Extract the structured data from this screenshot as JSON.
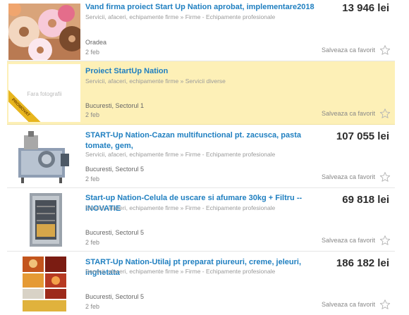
{
  "listings": [
    {
      "title": "Vand firma proiect Start Up Nation aprobat, implementare2018",
      "category": "Servicii, afaceri, echipamente firme » Firme - Echipamente profesionale",
      "price": "13 946 lei",
      "location": "Oradea",
      "date": "2 feb",
      "fav_label": "Salveaza ca favorit"
    },
    {
      "title": "Proiect StartUp Nation",
      "category": "Servicii, afaceri, echipamente firme » Servicii diverse",
      "price": "",
      "location": "Bucuresti, Sectorul 1",
      "date": "2 feb",
      "fav_label": "Salveaza ca favorit",
      "placeholder_text": "Fara fotografii",
      "promo_badge": "PROMOVAT"
    },
    {
      "title": "START-Up Nation-Cazan multifunctional pt. zacusca, pasta tomate, gem,",
      "category": "Servicii, afaceri, echipamente firme » Firme - Echipamente profesionale",
      "price": "107 055 lei",
      "location": "Bucuresti, Sectorul 5",
      "date": "2 feb",
      "fav_label": "Salveaza ca favorit"
    },
    {
      "title": "Start-up Nation-Celula de uscare si afumare 30kg + Filtru --INOVATIE",
      "category": "Servicii, afaceri, echipamente firme » Firme - Echipamente profesionale",
      "price": "69 818 lei",
      "location": "Bucuresti, Sectorul 5",
      "date": "2 feb",
      "fav_label": "Salveaza ca favorit"
    },
    {
      "title": "START-Up Nation-Utilaj pt preparat piureuri, creme, jeleuri, inghetata",
      "category": "Servicii, afaceri, echipamente firme » Firme - Echipamente profesionale",
      "price": "186 182 lei",
      "location": "Bucuresti, Sectorul 5",
      "date": "2 feb",
      "fav_label": "Salveaza ca favorit"
    }
  ],
  "colors": {
    "title_link": "#1f7fc0",
    "promoted_bg": "#fdf0b7",
    "promo_ribbon": "#e7b51e"
  },
  "icons": {
    "favorite": "star-outline-icon"
  }
}
